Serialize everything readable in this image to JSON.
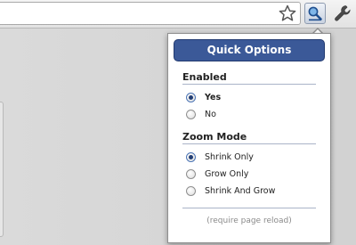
{
  "toolbar": {
    "icons": [
      "star-icon",
      "magnifier-icon",
      "wrench-icon"
    ]
  },
  "popup": {
    "header_label": "Quick Options",
    "header_color": "#3b5998",
    "sections": {
      "enabled": {
        "title": "Enabled",
        "options": [
          {
            "label": "Yes",
            "checked": true
          },
          {
            "label": "No",
            "checked": false
          }
        ]
      },
      "zoom_mode": {
        "title": "Zoom Mode",
        "options": [
          {
            "label": "Shrink Only",
            "checked": true
          },
          {
            "label": "Grow Only",
            "checked": false
          },
          {
            "label": "Shrink And Grow",
            "checked": false
          }
        ]
      }
    },
    "footer_note": "(require page reload)"
  }
}
